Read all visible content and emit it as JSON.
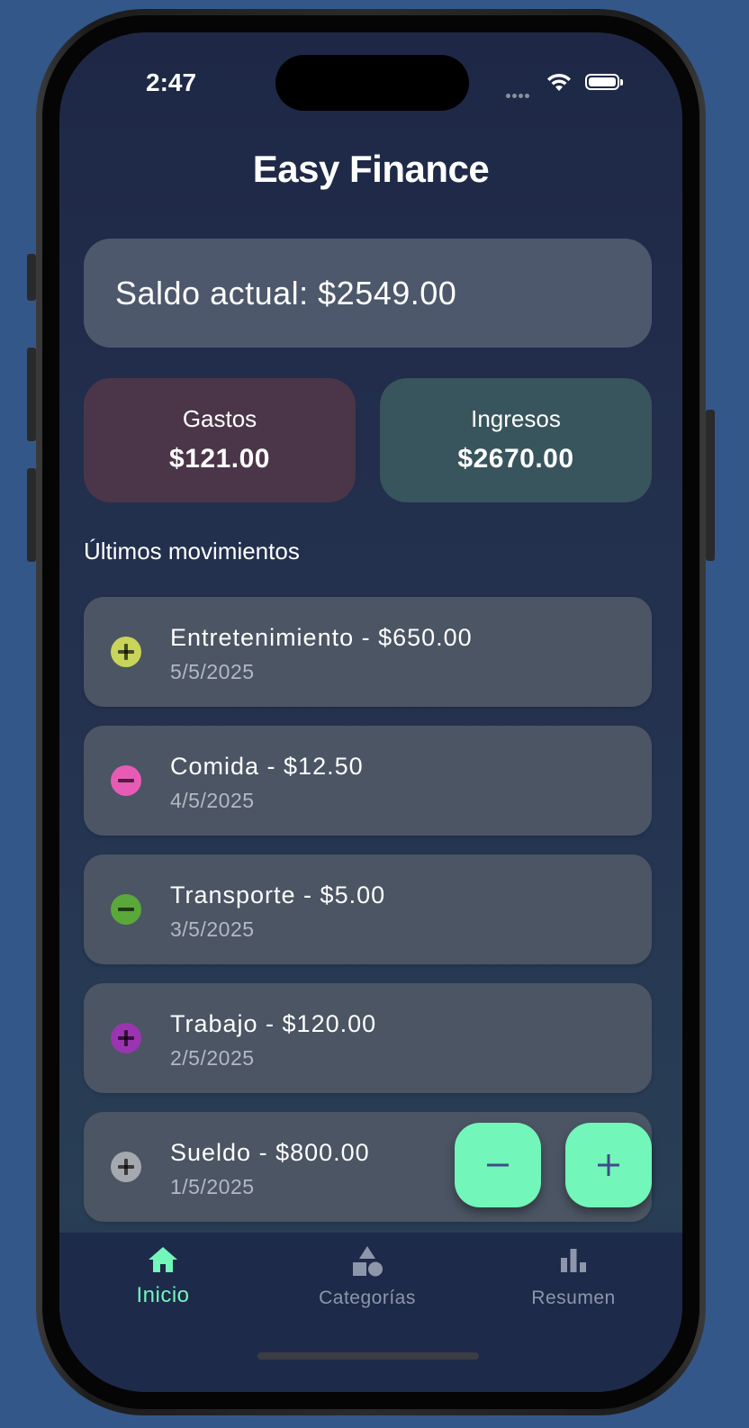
{
  "status_bar": {
    "time": "2:47"
  },
  "app": {
    "title": "Easy Finance"
  },
  "balance": {
    "text": "Saldo actual: $2549.00"
  },
  "stats": {
    "expenses": {
      "label": "Gastos",
      "value": "$121.00",
      "color": "#4a3648"
    },
    "income": {
      "label": "Ingresos",
      "value": "$2670.00",
      "color": "#38545c"
    }
  },
  "section": {
    "title": "Últimos movimientos"
  },
  "transactions": [
    {
      "title": "Entretenimiento - $650.00",
      "date": "5/5/2025",
      "icon": "plus-circle-icon",
      "color": "#c8d45a"
    },
    {
      "title": "Comida - $12.50",
      "date": "4/5/2025",
      "icon": "minus-circle-icon",
      "color": "#e85bb5"
    },
    {
      "title": "Transporte - $5.00",
      "date": "3/5/2025",
      "icon": "minus-circle-icon",
      "color": "#5aa83a"
    },
    {
      "title": "Trabajo - $120.00",
      "date": "2/5/2025",
      "icon": "plus-circle-icon",
      "color": "#9b34b0"
    },
    {
      "title": "Sueldo - $800.00",
      "date": "1/5/2025",
      "icon": "plus-circle-icon",
      "color": "#a5a8ae"
    }
  ],
  "fabs": {
    "accent_color": "#72f6b9",
    "minus_icon": "minus-icon",
    "plus_icon": "plus-icon"
  },
  "tabs": [
    {
      "label": "Inicio",
      "icon": "home-icon",
      "active": true
    },
    {
      "label": "Categorías",
      "icon": "shapes-icon",
      "active": false
    },
    {
      "label": "Resumen",
      "icon": "bar-chart-icon",
      "active": false
    }
  ]
}
